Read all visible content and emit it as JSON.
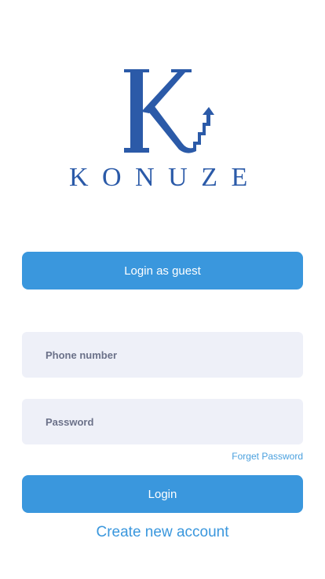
{
  "brand": {
    "logo_icon": "konuze-k-logo-icon",
    "wordmark": "KONUZE",
    "color": "#2b5aa8"
  },
  "actions": {
    "guest_login_label": "Login as guest",
    "login_label": "Login",
    "forgot_password_label": "Forget Password",
    "create_account_label": "Create new account"
  },
  "form": {
    "phone_placeholder": "Phone number",
    "password_placeholder": "Password"
  },
  "colors": {
    "primary_button": "#3a97dd",
    "input_background": "#eef0f8",
    "link": "#3a97dd"
  }
}
